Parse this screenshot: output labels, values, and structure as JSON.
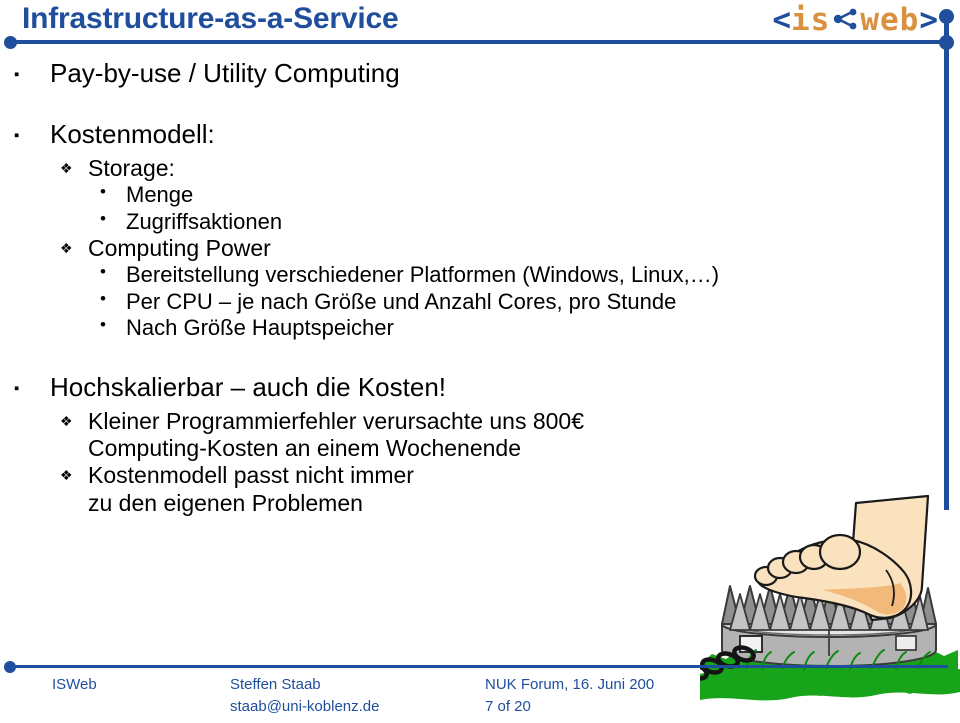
{
  "slide": {
    "title": "Infrastructure-as-a-Service",
    "logo": {
      "open_bracket": "<",
      "left_word": "is",
      "node_icon_name": "network-node-icon",
      "right_word": "web",
      "close_bracket": ">",
      "bracket_color": "#1F4E9C",
      "word_color": "#D9903F"
    },
    "accent_color": "#1F4E9C",
    "markers": {
      "level1": "▪",
      "level2": "❖",
      "level3": "•"
    },
    "content": [
      {
        "level": 1,
        "text": "Pay-by-use / Utility Computing"
      },
      {
        "level": 1,
        "text": "Kostenmodell:"
      },
      {
        "level": 2,
        "text": "Storage:"
      },
      {
        "level": 3,
        "text": "Menge"
      },
      {
        "level": 3,
        "text": "Zugriffsaktionen"
      },
      {
        "level": 2,
        "text": "Computing Power"
      },
      {
        "level": 3,
        "text": "Bereitstellung verschiedener Platformen (Windows, Linux,…)"
      },
      {
        "level": 3,
        "text": "Per CPU – je nach Größe und Anzahl Cores, pro Stunde"
      },
      {
        "level": 3,
        "text": "Nach Größe Hauptspeicher"
      },
      {
        "level": 1,
        "text": "Hochskalierbar – auch die Kosten!"
      },
      {
        "level": 2,
        "text": "Kleiner Programmierfehler verursachte uns 800€\nComputing-Kosten an einem Wochenende"
      },
      {
        "level": 2,
        "text": "Kostenmodell passt nicht immer\nzu den eigenen Problemen"
      }
    ],
    "footer": {
      "organisation": "ISWeb",
      "author": "Steffen Staab",
      "email": "staab@uni-koblenz.de",
      "event": "NUK Forum, 16. Juni 200",
      "page": "7 of 20"
    },
    "clipart": {
      "name": "foot-stepping-into-bear-trap",
      "grass_color": "#17A31A",
      "trap_color": "#9A9A9A",
      "skin_color": "#FBE2BE",
      "chain_color": "#141414",
      "stake_color": "#D9903F"
    }
  }
}
